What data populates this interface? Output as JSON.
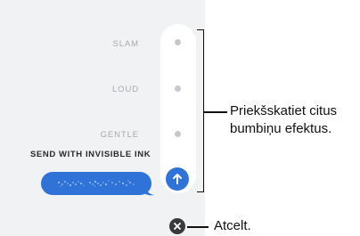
{
  "effects": {
    "slam_label": "SLAM",
    "loud_label": "LOUD",
    "gentle_label": "GENTLE",
    "send_with_invisible_ink": "SEND WITH INVISIBLE INK"
  },
  "colors": {
    "accent_blue": "#2f73d9",
    "panel_bg": "#f1f2f4",
    "label_gray": "#a7a9ad"
  },
  "icons": {
    "send": "arrow-up-icon",
    "cancel": "close-icon"
  },
  "callouts": {
    "preview_line1": "Priekšskatiet citus",
    "preview_line2": "bumbiņu efektus.",
    "cancel": "Atcelt."
  }
}
